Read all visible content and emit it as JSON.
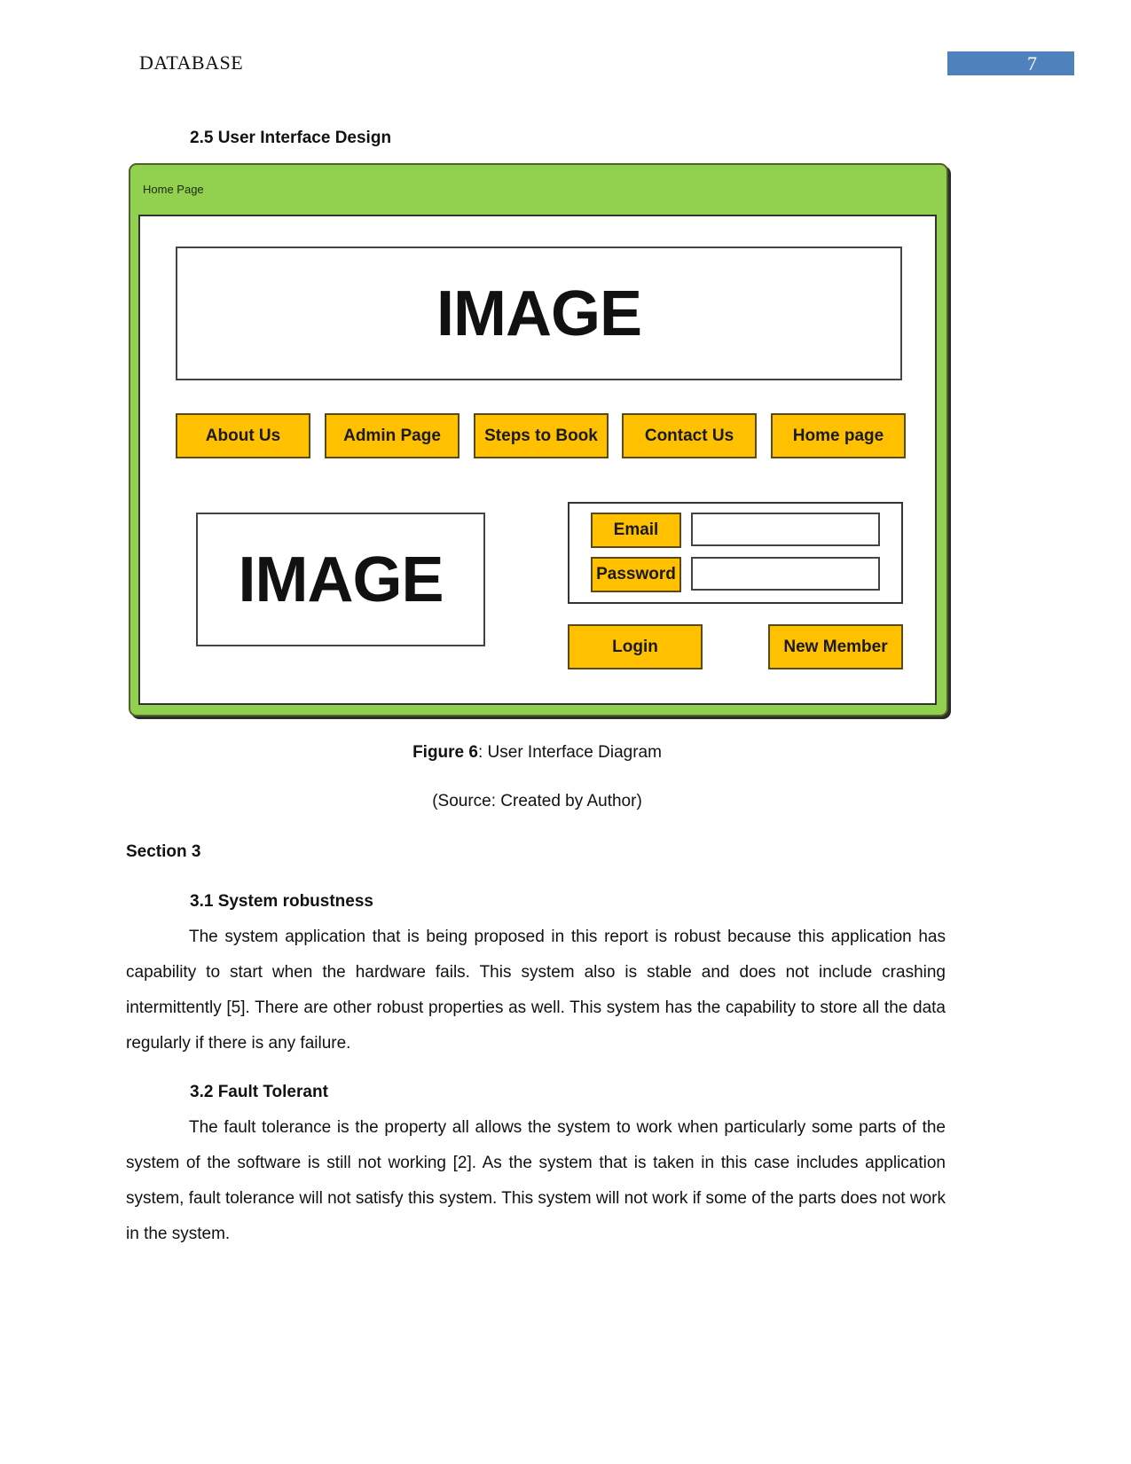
{
  "header": {
    "running_title": "DATABASE",
    "page_number": "7",
    "page_number_color": "#4f81bd"
  },
  "section_2_5": {
    "heading": "2.5 User Interface Design"
  },
  "mockup": {
    "window_title": "Home Page",
    "frame_color": "#92d050",
    "button_color": "#ffc000",
    "top_image_label": "IMAGE",
    "side_image_label": "IMAGE",
    "nav_buttons": [
      {
        "label": "About Us"
      },
      {
        "label": "Admin Page"
      },
      {
        "label": "Steps to Book"
      },
      {
        "label": "Contact Us"
      },
      {
        "label": "Home page"
      }
    ],
    "login_form": {
      "email_label": "Email",
      "email_value": "",
      "password_label": "Password",
      "password_value": ""
    },
    "login_button": "Login",
    "new_member_button": "New Member"
  },
  "figure": {
    "caption_bold": "Figure 6",
    "caption_rest": ": User Interface Diagram",
    "source": "(Source: Created by Author)"
  },
  "section_3": {
    "heading": "Section 3",
    "subsections": [
      {
        "heading": "3.1 System robustness",
        "body": "The system application that is being proposed in this report is robust because this application has capability to start when the hardware fails. This system also is stable and does not include crashing intermittently [5]. There are other robust properties as well. This system has the capability to store all the data regularly if there is any failure."
      },
      {
        "heading": "3.2 Fault Tolerant",
        "body": "The fault tolerance is the property all allows the system to work when particularly some parts of the system of the software is still not working [2]. As the system that is taken in this case includes application system, fault tolerance will not satisfy this system. This system will not work if some of the parts does not work in the system."
      }
    ]
  }
}
